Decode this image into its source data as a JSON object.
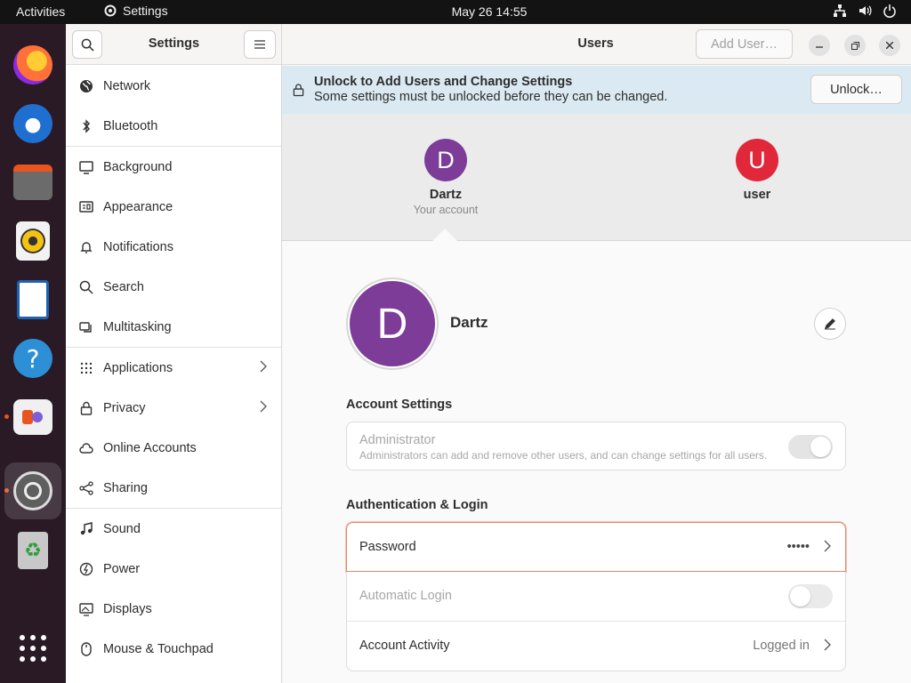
{
  "topbar": {
    "activities": "Activities",
    "app_name": "Settings",
    "clock": "May 26  14:55"
  },
  "sidebar": {
    "title": "Settings",
    "items": [
      {
        "label": "Network",
        "icon": "globe-icon"
      },
      {
        "label": "Bluetooth",
        "icon": "bluetooth-icon"
      },
      {
        "label": "Background",
        "icon": "monitor-icon"
      },
      {
        "label": "Appearance",
        "icon": "appearance-icon"
      },
      {
        "label": "Notifications",
        "icon": "bell-icon"
      },
      {
        "label": "Search",
        "icon": "search-icon"
      },
      {
        "label": "Multitasking",
        "icon": "multitasking-icon"
      },
      {
        "label": "Applications",
        "icon": "grid-icon"
      },
      {
        "label": "Privacy",
        "icon": "lock-icon"
      },
      {
        "label": "Online Accounts",
        "icon": "cloud-icon"
      },
      {
        "label": "Sharing",
        "icon": "share-icon"
      },
      {
        "label": "Sound",
        "icon": "music-note-icon"
      },
      {
        "label": "Power",
        "icon": "power-icon"
      },
      {
        "label": "Displays",
        "icon": "display-icon"
      },
      {
        "label": "Mouse & Touchpad",
        "icon": "mouse-icon"
      }
    ]
  },
  "header": {
    "title": "Users",
    "add_user": "Add User…"
  },
  "infobar": {
    "title": "Unlock to Add Users and Change Settings",
    "subtitle": "Some settings must be unlocked before they can be changed.",
    "button": "Unlock…"
  },
  "users": [
    {
      "initial": "D",
      "name": "Dartz",
      "sub": "Your account",
      "color": "#7d3c98"
    },
    {
      "initial": "U",
      "name": "user",
      "sub": "",
      "color": "#e0283a"
    }
  ],
  "profile": {
    "initial": "D",
    "name": "Dartz"
  },
  "account_settings": {
    "label": "Account Settings",
    "admin_title": "Administrator",
    "admin_desc": "Administrators can add and remove other users, and can change settings for all users."
  },
  "auth": {
    "label": "Authentication & Login",
    "password_label": "Password",
    "password_value": "•••••",
    "autologin_label": "Automatic Login",
    "activity_label": "Account Activity",
    "activity_value": "Logged in"
  },
  "colors": {
    "accent": "#e95420",
    "dock_bg": "#2a1a26",
    "infobar_bg": "#dbeaf2"
  }
}
